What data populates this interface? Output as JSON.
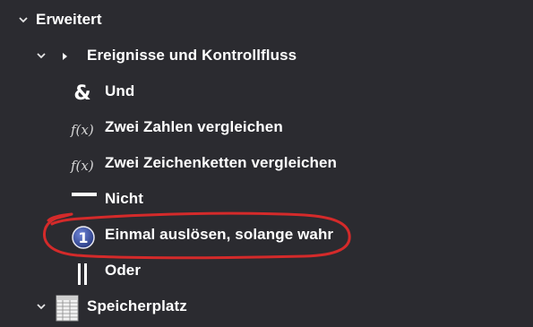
{
  "tree": {
    "items": [
      {
        "label": "Erweitert",
        "icon": "chevron-down-icon",
        "expanded": true,
        "level": 0
      },
      {
        "label": "Ereignisse und Kontrollfluss",
        "icon": "play-icon",
        "expanded": true,
        "level": 1
      },
      {
        "label": "Und",
        "icon": "ampersand-icon",
        "level": 2
      },
      {
        "label": "Zwei Zahlen vergleichen",
        "icon": "function-icon",
        "level": 2
      },
      {
        "label": "Zwei Zeichenketten vergleichen",
        "icon": "function-icon",
        "level": 2
      },
      {
        "label": "Nicht",
        "icon": "not-bar-icon",
        "level": 2
      },
      {
        "label": "Einmal auslösen, solange wahr",
        "icon": "number-one-icon",
        "level": 2,
        "annotated": true
      },
      {
        "label": "Oder",
        "icon": "or-bars-icon",
        "level": 2
      },
      {
        "label": "Speicherplatz",
        "icon": "table-icon",
        "expanded": true,
        "level": 1
      }
    ]
  },
  "glyphs": {
    "ampersand": "&",
    "function": "f(x)",
    "one": "1"
  },
  "colors": {
    "background": "#2b2b30",
    "text": "#ffffff",
    "annotation": "#d42a2a",
    "badge_blue": "#3a4fa3"
  }
}
